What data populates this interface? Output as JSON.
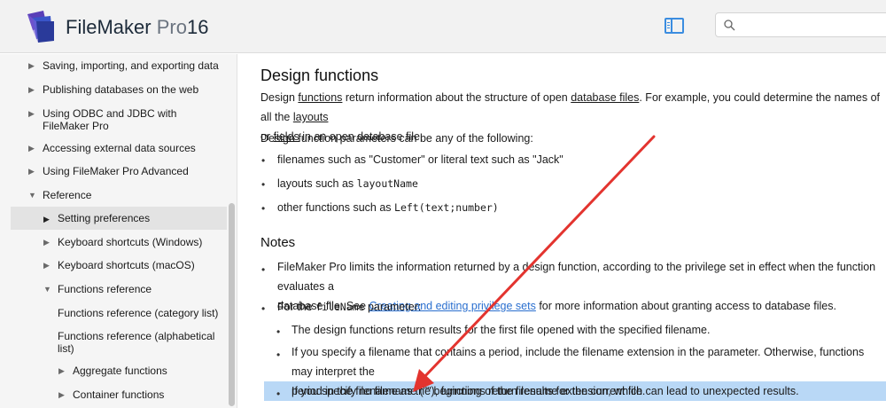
{
  "header": {
    "brand_name": "FileMaker",
    "brand_pro": "Pro",
    "brand_version": "16",
    "search": {
      "value": "",
      "placeholder": ""
    }
  },
  "icons": [
    "filemaker-logo-icon",
    "sidebar-toggle-icon",
    "search-icon",
    "triangle-right-icon",
    "triangle-down-icon"
  ],
  "colors": {
    "accent": "#3b8de0",
    "highlight": "#b9d8f6",
    "annotation_arrow": "#e3342f",
    "link": "#2a6fcf"
  },
  "sidebar": {
    "items": [
      {
        "label": "Saving, importing, and exporting data",
        "expanded": false
      },
      {
        "label": "Publishing databases on the web",
        "expanded": false
      },
      {
        "label": "Using ODBC and JDBC with",
        "label2": "FileMaker Pro",
        "expanded": false
      },
      {
        "label": "Accessing external data sources",
        "expanded": false
      },
      {
        "label": "Using FileMaker Pro Advanced",
        "expanded": false
      },
      {
        "label": "Reference",
        "expanded": true
      },
      {
        "label": "Setting preferences",
        "expanded": false,
        "selected": true
      },
      {
        "label": "Keyboard shortcuts (Windows)",
        "expanded": false
      },
      {
        "label": "Keyboard shortcuts (macOS)",
        "expanded": false
      },
      {
        "label": "Functions reference",
        "expanded": true
      },
      {
        "label": "Functions reference (category list)"
      },
      {
        "label": "Functions reference (alphabetical",
        "label2": "list)"
      },
      {
        "label": "Aggregate functions",
        "expanded": false
      },
      {
        "label": "Container functions",
        "expanded": false
      }
    ]
  },
  "content": {
    "title": "Design functions",
    "intro": {
      "t1": "Design ",
      "l1": "functions",
      "t2": " return information about the structure of open ",
      "l2": "database files",
      "t3": ". For example, you could determine the names of all the ",
      "l3": "layouts",
      "t4": "or ",
      "l4": "fields",
      "t5": " in an open database file."
    },
    "params_intro": "Design function parameters can be any of the following:",
    "params": [
      {
        "text": "filenames such as \"Customer\" or literal text such as \"Jack\""
      },
      {
        "text": "layouts such as ",
        "code": "layoutName"
      },
      {
        "text": "other functions such as ",
        "code": "Left(text;number)"
      }
    ],
    "notes_title": "Notes",
    "note1": {
      "line1": "FileMaker Pro limits the information returned by a design function, according to the privilege set in effect when the function evaluates a",
      "t1": "database file. See ",
      "link": "Creating and editing privilege sets",
      "t2": " for more information about granting access to database files."
    },
    "note2": {
      "t1": "For the ",
      "code": "fileName",
      "t2": " parameter:"
    },
    "sub_notes": [
      {
        "text": "The design functions return results for the first file opened with the specified filename."
      },
      {
        "line1": "If you specify a filename that contains a period, include the filename extension in the parameter. Otherwise, functions may interpret the",
        "line2": "period in the filename as the beginning of the filename extension, which can lead to unexpected results."
      },
      {
        "text": "If you specify no filename (\"\"), functions return results for the current file.",
        "highlighted": true
      }
    ],
    "bullet_glyph": "•"
  }
}
